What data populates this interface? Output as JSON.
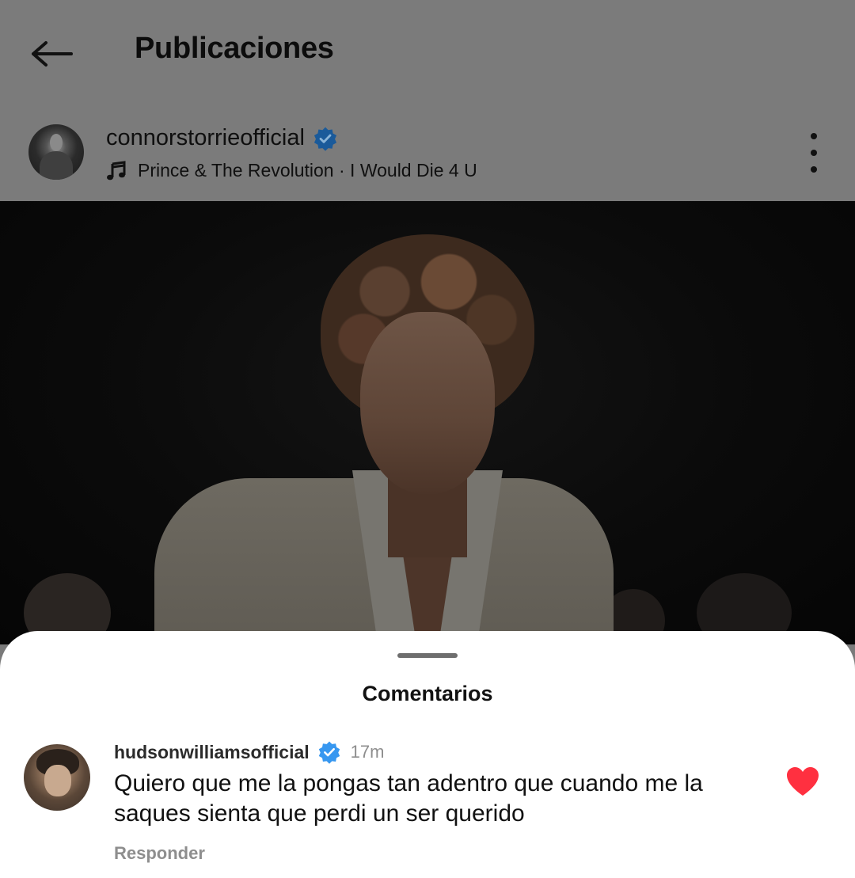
{
  "header": {
    "title": "Publicaciones",
    "back_icon": "arrow-left-icon"
  },
  "post": {
    "username": "connorstorrieofficial",
    "verified": true,
    "music": {
      "icon": "music-note-icon",
      "text": "Prince & The Revolution · I Would Die 4 U"
    },
    "more_icon": "more-vertical-icon"
  },
  "comments_sheet": {
    "title": "Comentarios",
    "comments": [
      {
        "username": "hudsonwilliamsofficial",
        "verified": true,
        "time": "17m",
        "text": "Quiero que me la pongas tan adentro que cuando me la saques sienta que perdi un ser querido",
        "liked": true,
        "reply_label": "Responder"
      }
    ]
  },
  "colors": {
    "dim_overlay": "#7b7b7b",
    "verified_blue": "#3797f0",
    "like_red": "#ff3040"
  }
}
